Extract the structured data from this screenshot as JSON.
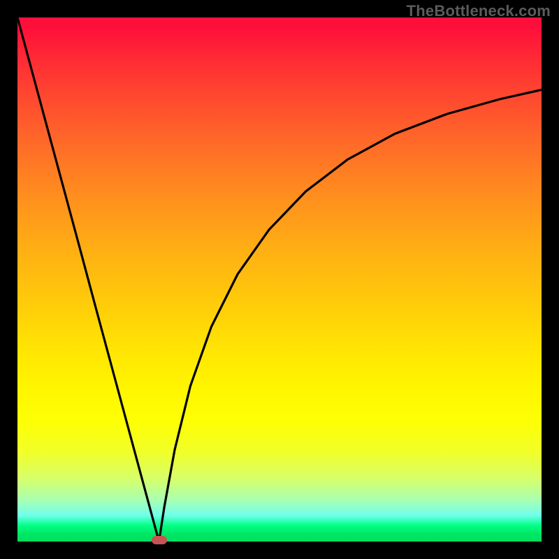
{
  "watermark": "TheBottleneck.com",
  "chart_data": {
    "type": "line",
    "x": [
      0,
      27,
      100
    ],
    "curve_points_left": [
      [
        0.0,
        100.0
      ],
      [
        3.0,
        88.9
      ],
      [
        6.0,
        77.8
      ],
      [
        9.0,
        66.7
      ],
      [
        12.0,
        55.6
      ],
      [
        15.0,
        44.4
      ],
      [
        18.0,
        33.3
      ],
      [
        21.0,
        22.2
      ],
      [
        24.0,
        11.1
      ],
      [
        27.0,
        0.0
      ]
    ],
    "curve_points_right": [
      [
        27.0,
        0.0
      ],
      [
        28.0,
        6.5
      ],
      [
        30.0,
        17.5
      ],
      [
        33.0,
        29.7
      ],
      [
        37.0,
        41.0
      ],
      [
        42.0,
        51.0
      ],
      [
        48.0,
        59.5
      ],
      [
        55.0,
        66.8
      ],
      [
        63.0,
        72.9
      ],
      [
        72.0,
        77.8
      ],
      [
        82.0,
        81.6
      ],
      [
        92.0,
        84.4
      ],
      [
        100.0,
        86.2
      ]
    ],
    "marker": {
      "x": 27.0,
      "y": 0.0
    },
    "xlabel": "",
    "ylabel": "",
    "title": "",
    "xlim": [
      0,
      100
    ],
    "ylim": [
      0,
      100
    ]
  },
  "colors": {
    "curve": "#000000",
    "marker": "#c95353",
    "frame": "#000000"
  }
}
